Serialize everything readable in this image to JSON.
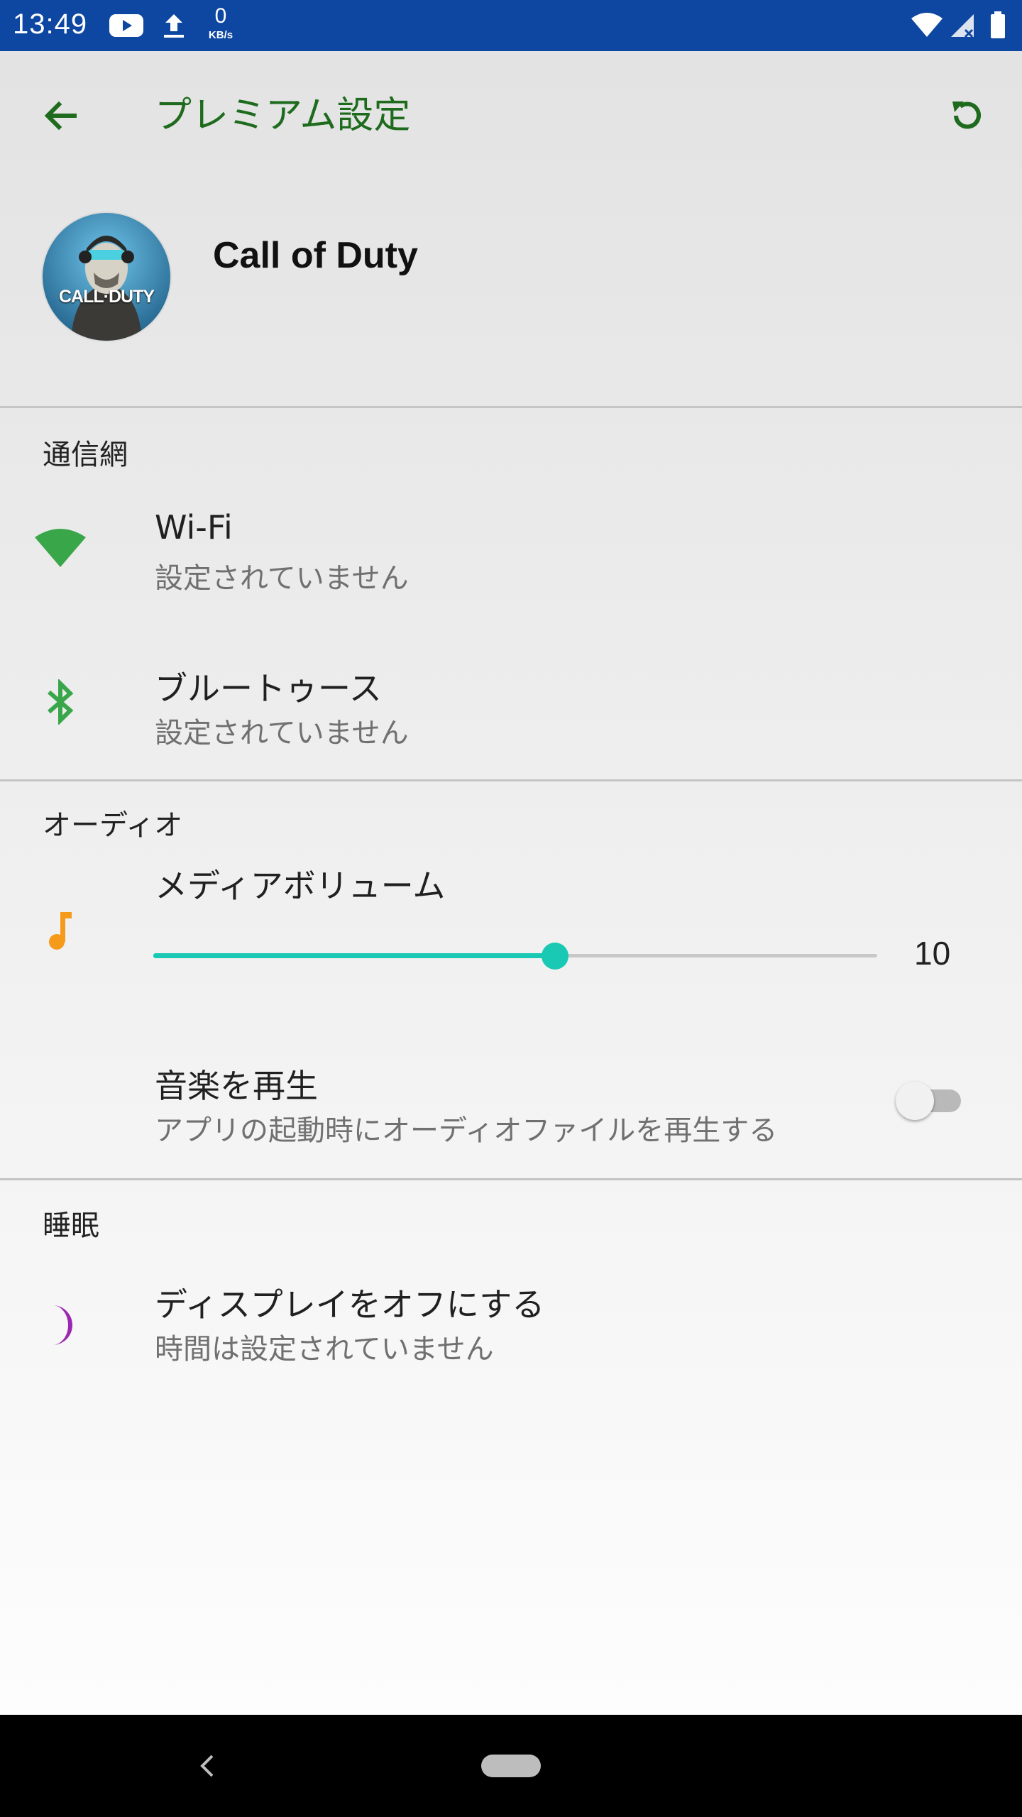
{
  "status_bar": {
    "time": "13:49",
    "net_speed_value": "0",
    "net_speed_unit": "KB/s",
    "icons": [
      "youtube-icon",
      "upload-icon",
      "wifi-icon",
      "signal-icon",
      "battery-icon"
    ]
  },
  "app_bar": {
    "title": "プレミアム設定",
    "back_icon": "arrow-back-icon",
    "refresh_icon": "refresh-icon",
    "accent_color": "#1e6b1e"
  },
  "game": {
    "name": "Call of Duty",
    "logo_text": "CALL·DUTY"
  },
  "sections": {
    "network": {
      "title": "通信網",
      "wifi": {
        "title": "Wi-Fi",
        "subtitle": "設定されていません",
        "icon": "wifi-icon",
        "color": "#3aa64a"
      },
      "bluetooth": {
        "title": "ブルートゥース",
        "subtitle": "設定されていません",
        "icon": "bluetooth-icon",
        "color": "#3aa64a"
      }
    },
    "audio": {
      "title": "オーディオ",
      "media_volume": {
        "title": "メディアボリューム",
        "value": "10",
        "fraction": 0.555,
        "icon": "music-note-icon",
        "color": "#f59a1b",
        "slider_color": "#19c9b3"
      },
      "play_music": {
        "title": "音楽を再生",
        "subtitle": "アプリの起動時にオーディオファイルを再生する",
        "enabled": false
      }
    },
    "sleep": {
      "title": "睡眠",
      "display_off": {
        "title": "ディスプレイをオフにする",
        "subtitle": "時間は設定されていません",
        "icon": "moon-icon",
        "color": "#9c27b0"
      }
    }
  },
  "nav_bar": {
    "back_icon": "nav-back-icon",
    "home_icon": "home-pill-icon"
  }
}
